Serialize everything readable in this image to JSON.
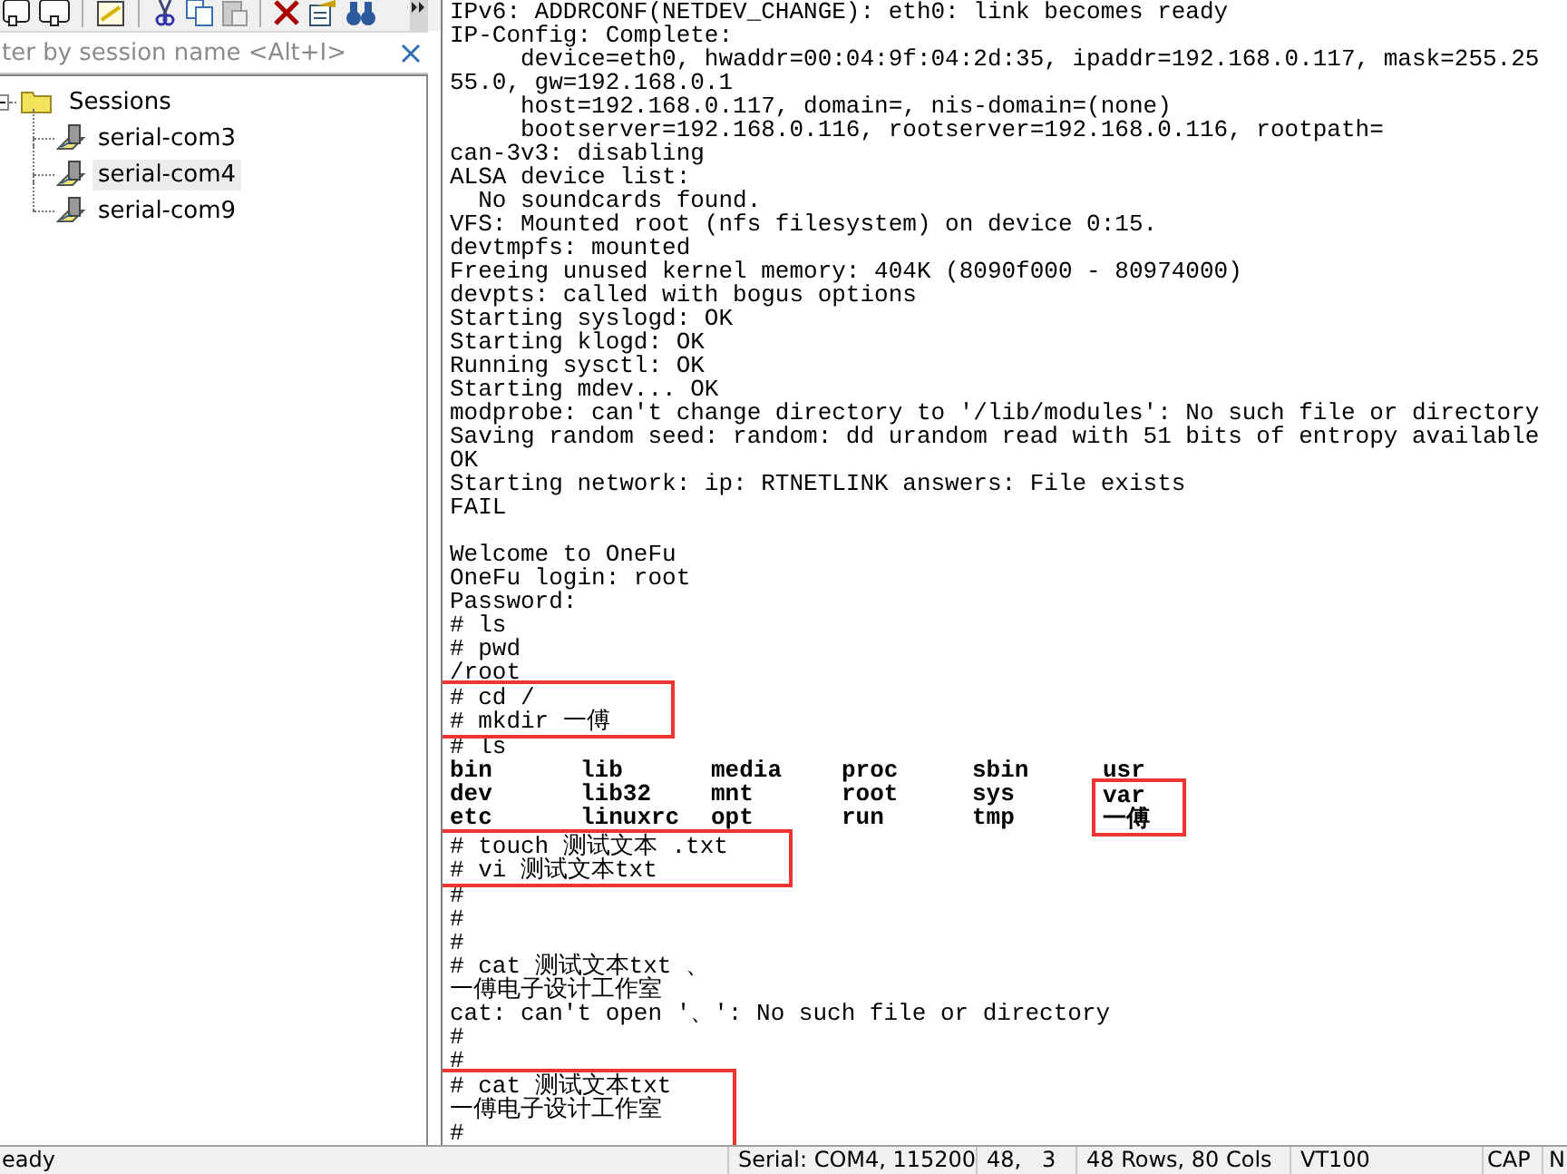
{
  "filter": {
    "placeholder": "ter by session name <Alt+I>"
  },
  "sessions": {
    "label": "Sessions",
    "expanded": true,
    "children": [
      {
        "label": "serial-com3",
        "selected": false
      },
      {
        "label": "serial-com4",
        "selected": true
      },
      {
        "label": "serial-com9",
        "selected": false
      }
    ]
  },
  "terminal": {
    "lines": [
      {
        "kind": "text",
        "text": "IPv6: ADDRCONF(NETDEV_CHANGE): eth0: link becomes ready",
        "highlight": false
      },
      {
        "kind": "text",
        "text": "IP-Config: Complete:",
        "highlight": false
      },
      {
        "kind": "text",
        "text": "     device=eth0, hwaddr=00:04:9f:04:2d:35, ipaddr=192.168.0.117, mask=255.25",
        "highlight": false
      },
      {
        "kind": "text",
        "text": "55.0, gw=192.168.0.1",
        "highlight": false
      },
      {
        "kind": "text",
        "text": "     host=192.168.0.117, domain=, nis-domain=(none)",
        "highlight": false
      },
      {
        "kind": "text",
        "text": "     bootserver=192.168.0.116, rootserver=192.168.0.116, rootpath=",
        "highlight": false
      },
      {
        "kind": "text",
        "text": "can-3v3: disabling",
        "highlight": false
      },
      {
        "kind": "text",
        "text": "ALSA device list:",
        "highlight": false
      },
      {
        "kind": "text",
        "text": "  No soundcards found.",
        "highlight": false
      },
      {
        "kind": "text",
        "text": "VFS: Mounted root (nfs filesystem) on device 0:15.",
        "highlight": false
      },
      {
        "kind": "text",
        "text": "devtmpfs: mounted",
        "highlight": false
      },
      {
        "kind": "text",
        "text": "Freeing unused kernel memory: 404K (8090f000 - 80974000)",
        "highlight": false
      },
      {
        "kind": "text",
        "text": "devpts: called with bogus options",
        "highlight": false
      },
      {
        "kind": "text",
        "text": "Starting syslogd: OK",
        "highlight": false
      },
      {
        "kind": "text",
        "text": "Starting klogd: OK",
        "highlight": false
      },
      {
        "kind": "text",
        "text": "Running sysctl: OK",
        "highlight": false
      },
      {
        "kind": "text",
        "text": "Starting mdev... OK",
        "highlight": false
      },
      {
        "kind": "text",
        "text": "modprobe: can't change directory to '/lib/modules': No such file or directory",
        "highlight": false
      },
      {
        "kind": "text",
        "text": "Saving random seed: random: dd urandom read with 51 bits of entropy available",
        "highlight": false
      },
      {
        "kind": "text",
        "text": "OK",
        "highlight": false
      },
      {
        "kind": "text",
        "text": "Starting network: ip: RTNETLINK answers: File exists",
        "highlight": false
      },
      {
        "kind": "text",
        "text": "FAIL",
        "highlight": false
      },
      {
        "kind": "blank"
      },
      {
        "kind": "text",
        "text": "Welcome to OneFu",
        "highlight": false
      },
      {
        "kind": "text",
        "text": "OneFu login: root",
        "highlight": false
      },
      {
        "kind": "text",
        "text": "Password:",
        "highlight": false
      },
      {
        "kind": "text",
        "text": "# ls",
        "highlight": false
      },
      {
        "kind": "text",
        "text": "# pwd",
        "highlight": false
      },
      {
        "kind": "text",
        "text": "/root",
        "highlight": false
      },
      {
        "kind": "text",
        "text": "# cd /",
        "highlight": true
      },
      {
        "kind": "text",
        "text": "# mkdir 一傅",
        "highlight": true
      },
      {
        "kind": "text",
        "text": "# ls",
        "highlight": false
      },
      {
        "kind": "listing",
        "columns": [
          {
            "entries": [
              {
                "text": "bin",
                "highlight": false
              },
              {
                "text": "dev",
                "highlight": false
              },
              {
                "text": "etc",
                "highlight": false
              }
            ]
          },
          {
            "entries": [
              {
                "text": "lib",
                "highlight": false
              },
              {
                "text": "lib32",
                "highlight": false
              },
              {
                "text": "linuxrc",
                "highlight": false
              }
            ]
          },
          {
            "entries": [
              {
                "text": "media",
                "highlight": false
              },
              {
                "text": "mnt",
                "highlight": false
              },
              {
                "text": "opt",
                "highlight": false
              }
            ]
          },
          {
            "entries": [
              {
                "text": "proc",
                "highlight": false
              },
              {
                "text": "root",
                "highlight": false
              },
              {
                "text": "run",
                "highlight": false
              }
            ]
          },
          {
            "entries": [
              {
                "text": "sbin",
                "highlight": false
              },
              {
                "text": "sys",
                "highlight": false
              },
              {
                "text": "tmp",
                "highlight": false
              }
            ]
          },
          {
            "entries": [
              {
                "text": "usr",
                "highlight": false
              },
              {
                "text": "var",
                "highlight": true
              },
              {
                "text": "一傅",
                "highlight": true
              }
            ]
          }
        ]
      },
      {
        "kind": "text",
        "text": "# touch 测试文本 .txt",
        "highlight": true
      },
      {
        "kind": "text",
        "text": "# vi 测试文本txt",
        "highlight": true
      },
      {
        "kind": "text",
        "text": "#",
        "highlight": false
      },
      {
        "kind": "text",
        "text": "#",
        "highlight": false
      },
      {
        "kind": "text",
        "text": "#",
        "highlight": false
      },
      {
        "kind": "text",
        "text": "# cat 测试文本txt 、",
        "highlight": false
      },
      {
        "kind": "text",
        "text": "一傅电子设计工作室",
        "highlight": false
      },
      {
        "kind": "text",
        "text": "cat: can't open '、': No such file or directory",
        "highlight": false
      },
      {
        "kind": "text",
        "text": "#",
        "highlight": false
      },
      {
        "kind": "text",
        "text": "#",
        "highlight": false
      },
      {
        "kind": "text",
        "text": "# cat 测试文本txt",
        "highlight": true
      },
      {
        "kind": "text",
        "text": "一傅电子设计工作室",
        "highlight": true
      },
      {
        "kind": "text",
        "text": "#",
        "highlight": true
      }
    ]
  },
  "status_bar": [
    "eady",
    "Serial: COM4, 115200",
    "48,   3",
    "48 Rows, 80 Cols",
    "VT100",
    "CAP",
    "N"
  ]
}
